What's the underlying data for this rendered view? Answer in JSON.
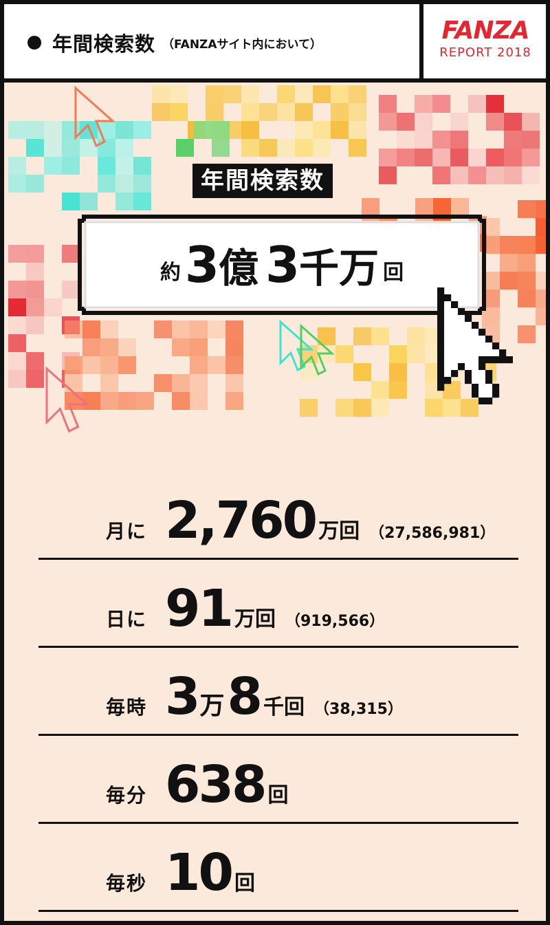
{
  "header": {
    "title": "年間検索数",
    "subtitle": "（FANZAサイト内において）",
    "logo": {
      "word": "FANZA",
      "sub": "REPORT 2018"
    }
  },
  "hero": {
    "label": "年間検索数",
    "prefix": "約",
    "num1": "3",
    "kanji1": "億",
    "num2": "3",
    "kanji2": "千万",
    "suffix": "回"
  },
  "stats": [
    {
      "label": "月に",
      "number": "2,760",
      "unit": "万回",
      "exact": "（27,586,981）"
    },
    {
      "label": "日に",
      "number": "91",
      "unit": "万回",
      "exact": "（919,566）"
    },
    {
      "label": "毎時",
      "number_a": "3",
      "mid": "万",
      "number_b": "8",
      "unit": "千回",
      "exact": "（38,315）"
    },
    {
      "label": "毎分",
      "number": "638",
      "unit": "回"
    },
    {
      "label": "毎秒",
      "number": "10",
      "unit": "回"
    }
  ],
  "colors": {
    "background": "#fbeadb",
    "brand": "#e3262f",
    "ink": "#111111"
  }
}
